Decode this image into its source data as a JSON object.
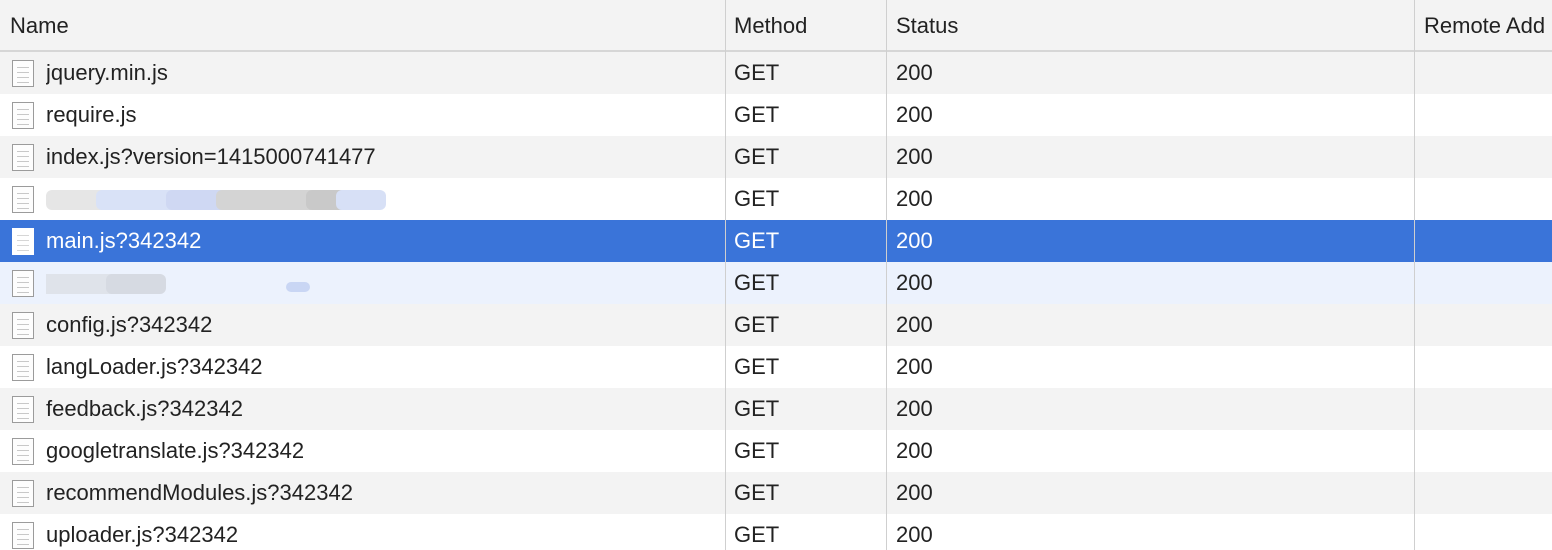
{
  "columns": {
    "name": "Name",
    "method": "Method",
    "status": "Status",
    "remote": "Remote Add"
  },
  "rows": [
    {
      "name": "jquery.min.js",
      "method": "GET",
      "status": "200"
    },
    {
      "name": "require.js",
      "method": "GET",
      "status": "200"
    },
    {
      "name": "index.js?version=1415000741477",
      "method": "GET",
      "status": "200"
    },
    {
      "name": "",
      "method": "GET",
      "status": "200"
    },
    {
      "name": "main.js?342342",
      "method": "GET",
      "status": "200"
    },
    {
      "name": "",
      "method": "GET",
      "status": "200"
    },
    {
      "name": "config.js?342342",
      "method": "GET",
      "status": "200"
    },
    {
      "name": "langLoader.js?342342",
      "method": "GET",
      "status": "200"
    },
    {
      "name": "feedback.js?342342",
      "method": "GET",
      "status": "200"
    },
    {
      "name": "googletranslate.js?342342",
      "method": "GET",
      "status": "200"
    },
    {
      "name": "recommendModules.js?342342",
      "method": "GET",
      "status": "200"
    },
    {
      "name": "uploader.js?342342",
      "method": "GET",
      "status": "200"
    }
  ],
  "selected_row": "main.js?342342",
  "colors": {
    "selected": "#3a74d9",
    "hover": "#ecf2fd",
    "stripe": "#f3f3f3"
  }
}
